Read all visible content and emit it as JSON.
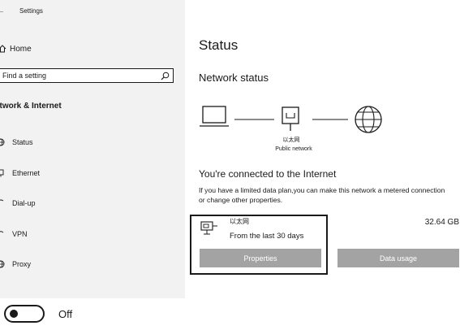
{
  "window": {
    "title": "Settings",
    "back_glyph": "←"
  },
  "sidebar": {
    "home_label": "Home",
    "search": {
      "placeholder": "Find a setting"
    },
    "section_header": "etwork & Internet",
    "items": [
      {
        "label": "Status",
        "icon": "globe-icon"
      },
      {
        "label": "Ethernet",
        "icon": "ethernet-icon"
      },
      {
        "label": "Dial-up",
        "icon": "dialup-icon"
      },
      {
        "label": "VPN",
        "icon": "vpn-icon"
      },
      {
        "label": "Proxy",
        "icon": "proxy-globe-icon"
      }
    ]
  },
  "main": {
    "title": "Status",
    "network_status_heading": "Network status",
    "diagram": {
      "adapter_label": "以太网",
      "network_label": "Public network"
    },
    "connected_heading": "You're connected to the Internet",
    "info_text": "If you have a limited data plan,you can make this network a metered connection or change other properties.",
    "adapter": {
      "name": "以太网",
      "period": "From the last 30 days",
      "usage": "32.64 GB"
    },
    "properties_button": "Properties",
    "data_usage_button": "Data usage"
  },
  "toggle": {
    "state_label": "Off"
  },
  "colors": {
    "sidebar_bg": "#f2f2f2",
    "button_bg": "#a3a3a3",
    "text": "#1a1a1a"
  }
}
